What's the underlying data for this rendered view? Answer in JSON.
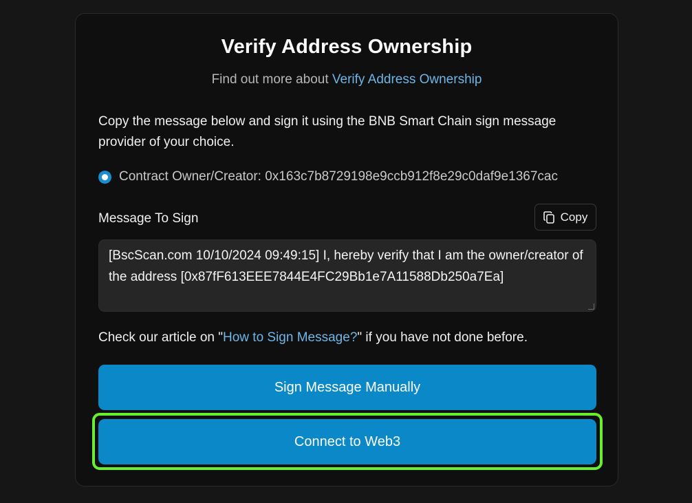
{
  "header": {
    "title": "Verify Address Ownership",
    "subtitle_prefix": "Find out more about ",
    "subtitle_link": "Verify Address Ownership"
  },
  "instructions": "Copy the message below and sign it using the BNB Smart Chain sign message provider of your choice.",
  "owner_option": {
    "label": "Contract Owner/Creator: 0x163c7b8729198e9ccb912f8e29c0daf9e1367cac",
    "selected": true
  },
  "message": {
    "label": "Message To Sign",
    "copy_label": "Copy",
    "text": "[BscScan.com 10/10/2024 09:49:15] I, hereby verify that I am the owner/creator of the address [0x87fF613EEE7844E4FC29Bb1e7A11588Db250a7Ea]"
  },
  "article": {
    "prefix": "Check our article on \"",
    "link": "How to Sign Message?",
    "suffix": "\" if you have not done before."
  },
  "buttons": {
    "sign_manually": "Sign Message Manually",
    "connect_web3": "Connect to Web3"
  },
  "colors": {
    "primary_button": "#0a88c8",
    "link": "#6fb6e6",
    "highlight": "#6aef2e",
    "card_bg": "#0f0f0f",
    "page_bg": "#161616"
  }
}
